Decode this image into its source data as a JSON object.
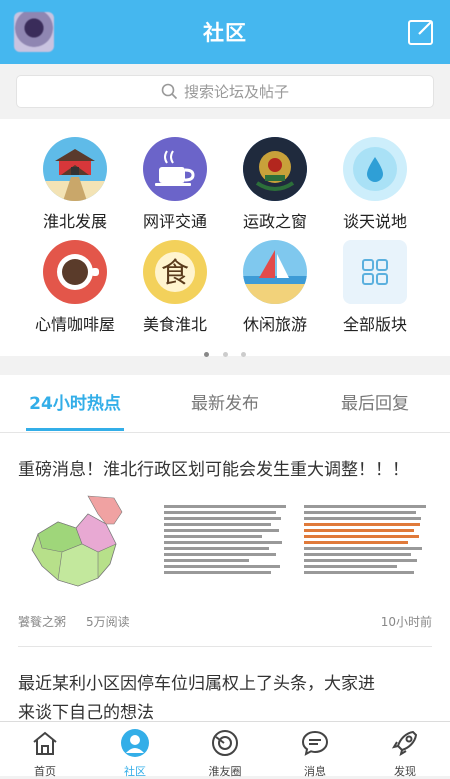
{
  "header": {
    "title": "社区",
    "compose_icon": "compose-icon"
  },
  "search": {
    "placeholder": "搜索论坛及帖子"
  },
  "categories": [
    {
      "label": "淮北发展",
      "icon": "city-gate-icon",
      "color": "#5fbbe8"
    },
    {
      "label": "网评交通",
      "icon": "coffee-cup-icon",
      "color": "#6b64c9"
    },
    {
      "label": "运政之窗",
      "icon": "emblem-icon",
      "color": "#2c5f9e"
    },
    {
      "label": "谈天说地",
      "icon": "water-drop-icon",
      "color": "#8fd5f2"
    },
    {
      "label": "心情咖啡屋",
      "icon": "coffee-top-icon",
      "color": "#e3564a"
    },
    {
      "label": "美食淮北",
      "icon": "food-icon",
      "color": "#f3d15b"
    },
    {
      "label": "休闲旅游",
      "icon": "sailboat-icon",
      "color": "#7fc8ee"
    },
    {
      "label": "全部版块",
      "icon": "grid-icon",
      "color": "#e8f3fb"
    }
  ],
  "tabs": [
    {
      "label": "24小时热点",
      "active": true
    },
    {
      "label": "最新发布",
      "active": false
    },
    {
      "label": "最后回复",
      "active": false
    }
  ],
  "posts": [
    {
      "title": "重磅消息！淮北行政区划可能会发生重大调整！！！",
      "author": "饕餮之粥",
      "reads": "5万阅读",
      "time": "10小时前"
    },
    {
      "title_line1": "最近某利小区因停车位归属权上了头条，大家进",
      "title_line2": "来谈下自己的想法"
    }
  ],
  "bottom_nav": [
    {
      "label": "首页",
      "icon": "home-icon",
      "active": false
    },
    {
      "label": "社区",
      "icon": "community-icon",
      "active": true
    },
    {
      "label": "淮友圈",
      "icon": "circle-icon",
      "active": false
    },
    {
      "label": "消息",
      "icon": "message-icon",
      "active": false
    },
    {
      "label": "发现",
      "icon": "rocket-icon",
      "active": false
    }
  ],
  "colors": {
    "accent": "#33aee8",
    "header": "#45b7ef"
  }
}
